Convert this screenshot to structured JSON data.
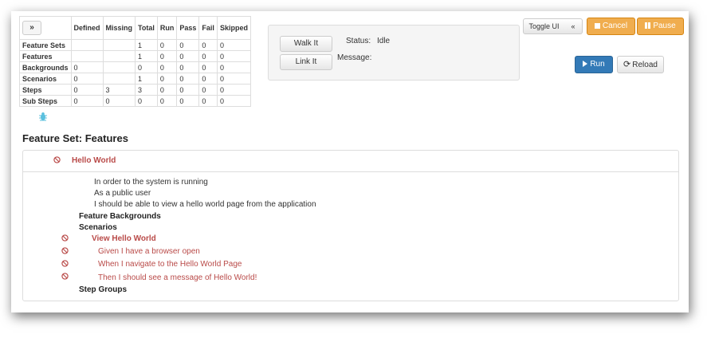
{
  "stats": {
    "expand_label": "»",
    "headers": [
      "Defined",
      "Missing",
      "Total",
      "Run",
      "Pass",
      "Fail",
      "Skipped"
    ],
    "rows": [
      {
        "label": "Feature Sets",
        "cells": [
          "",
          "",
          "1",
          "0",
          "0",
          "0",
          "0"
        ]
      },
      {
        "label": "Features",
        "cells": [
          "",
          "",
          "1",
          "0",
          "0",
          "0",
          "0"
        ]
      },
      {
        "label": "Backgrounds",
        "cells": [
          "0",
          "",
          "0",
          "0",
          "0",
          "0",
          "0"
        ]
      },
      {
        "label": "Scenarios",
        "cells": [
          "0",
          "",
          "1",
          "0",
          "0",
          "0",
          "0"
        ]
      },
      {
        "label": "Steps",
        "cells": [
          "0",
          "3",
          "3",
          "0",
          "0",
          "0",
          "0"
        ]
      },
      {
        "label": "Sub Steps",
        "cells": [
          "0",
          "0",
          "0",
          "0",
          "0",
          "0",
          "0"
        ]
      }
    ]
  },
  "panel": {
    "walk_label": "Walk It",
    "link_label": "Link It",
    "status_label": "Status:",
    "status_value": "Idle",
    "message_label": "Message:",
    "message_value": ""
  },
  "toolbar": {
    "toggle_label": "Toggle UI",
    "collapse_label": "«",
    "cancel_label": "Cancel",
    "pause_label": "Pause",
    "run_label": "Run",
    "reload_label": "Reload"
  },
  "feature_set": {
    "title": "Feature Set: Features",
    "feature_name": "Hello World",
    "narrative": [
      "In order to the system is running",
      "As a public user",
      "I should be able to view a hello world page from the application"
    ],
    "backgrounds_label": "Feature Backgrounds",
    "scenarios_label": "Scenarios",
    "scenario_name": "View Hello World",
    "steps": [
      "Given I have a browser open",
      "When I navigate to the Hello World Page",
      "Then I should see a message of Hello World!"
    ],
    "step_groups_label": "Step Groups"
  },
  "colors": {
    "warning": "#f0ad4e",
    "primary": "#337ab7",
    "failed": "#b94a48"
  }
}
